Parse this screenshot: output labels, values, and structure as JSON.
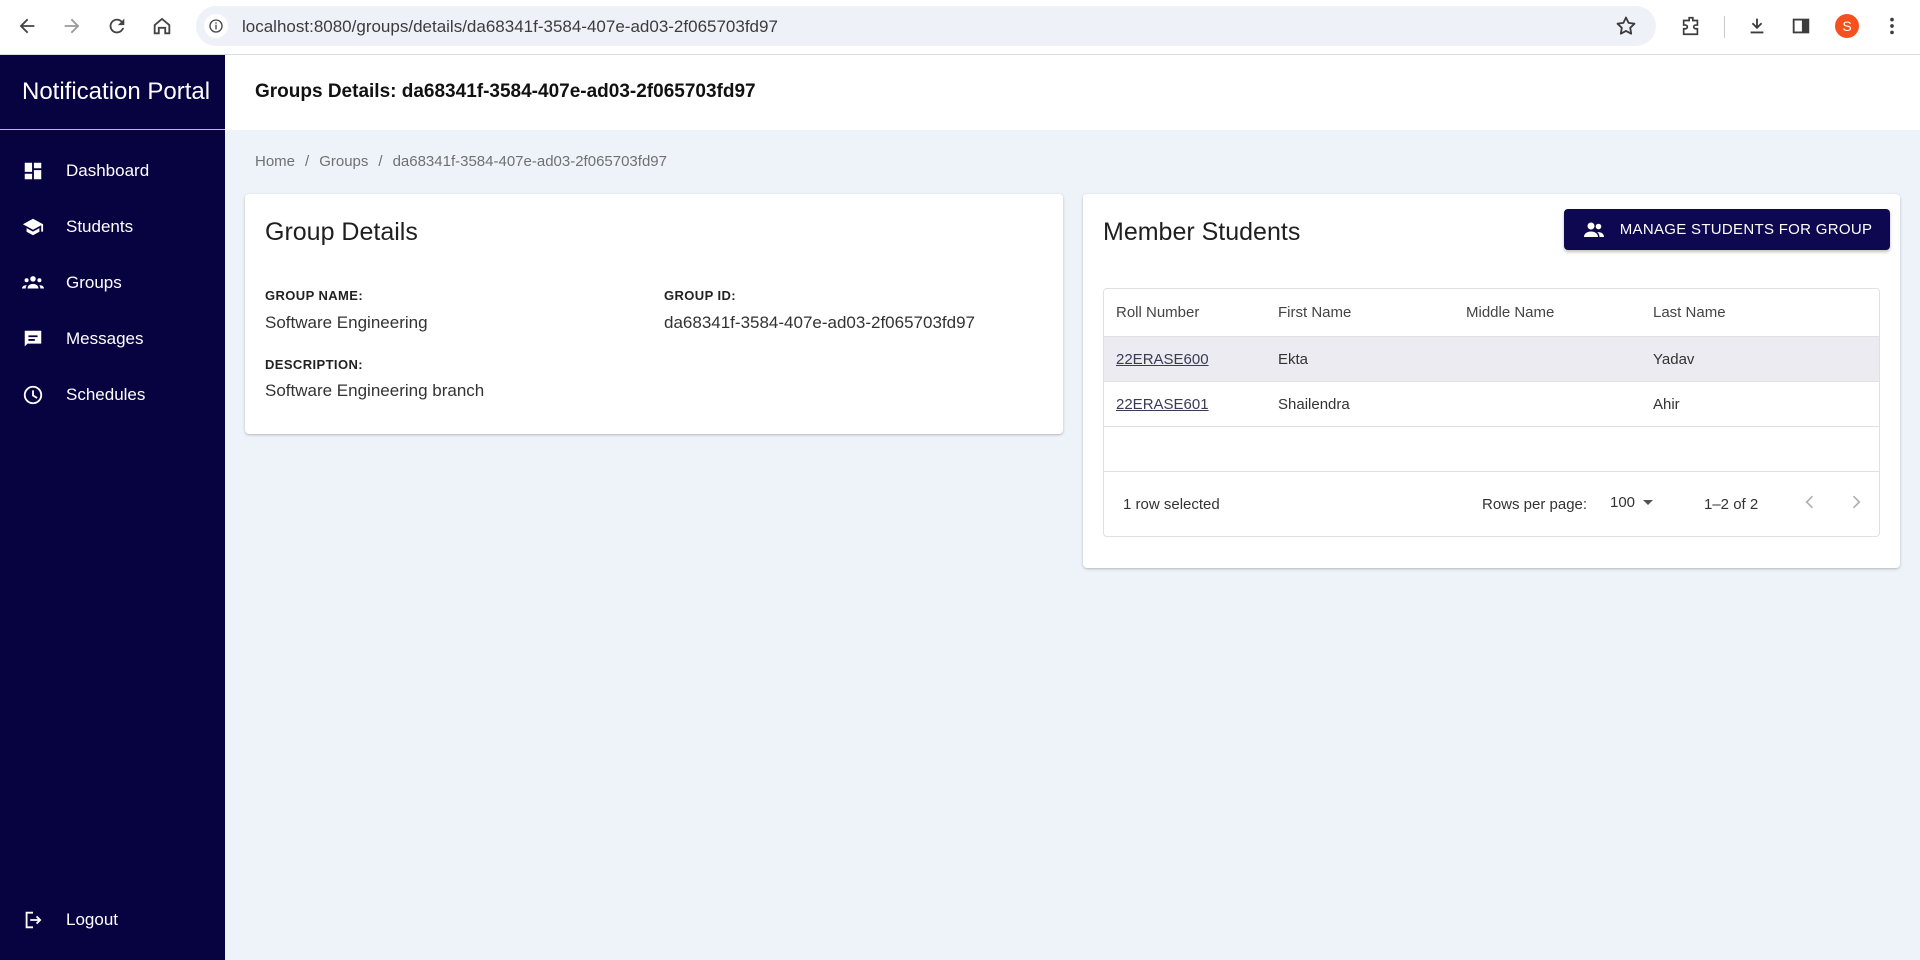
{
  "browser": {
    "url": "localhost:8080/groups/details/da68341f-3584-407e-ad03-2f065703fd97",
    "avatar_letter": "S"
  },
  "sidebar": {
    "brand": "Notification Portal",
    "items": [
      {
        "label": "Dashboard",
        "icon": "dashboard-icon"
      },
      {
        "label": "Students",
        "icon": "school-icon"
      },
      {
        "label": "Groups",
        "icon": "groups-icon"
      },
      {
        "label": "Messages",
        "icon": "chat-icon"
      },
      {
        "label": "Schedules",
        "icon": "clock-icon"
      }
    ],
    "logout": {
      "label": "Logout",
      "icon": "logout-icon"
    }
  },
  "topbar": {
    "title": "Groups Details: da68341f-3584-407e-ad03-2f065703fd97"
  },
  "breadcrumb": [
    "Home",
    "Groups",
    "da68341f-3584-407e-ad03-2f065703fd97"
  ],
  "group_details": {
    "title": "Group Details",
    "name_label": "GROUP NAME:",
    "name_value": "Software Engineering",
    "id_label": "GROUP ID:",
    "id_value": "da68341f-3584-407e-ad03-2f065703fd97",
    "description_label": "DESCRIPTION:",
    "description_value": "Software Engineering branch"
  },
  "members": {
    "title": "Member Students",
    "manage_button": "MANAGE STUDENTS FOR GROUP",
    "columns": [
      "Roll Number",
      "First Name",
      "Middle Name",
      "Last Name"
    ],
    "rows": [
      {
        "roll": "22ERASE600",
        "first": "Ekta",
        "middle": "",
        "last": "Yadav",
        "selected": true
      },
      {
        "roll": "22ERASE601",
        "first": "Shailendra",
        "middle": "",
        "last": "Ahir",
        "selected": false
      }
    ],
    "footer": {
      "selection": "1 row selected",
      "rows_per_page_label": "Rows per page:",
      "rows_per_page_value": "100",
      "range": "1–2 of 2"
    }
  },
  "colors": {
    "sidebar_bg": "#070240",
    "accent_button": "#0d0850",
    "page_bg": "#eef3fa"
  }
}
